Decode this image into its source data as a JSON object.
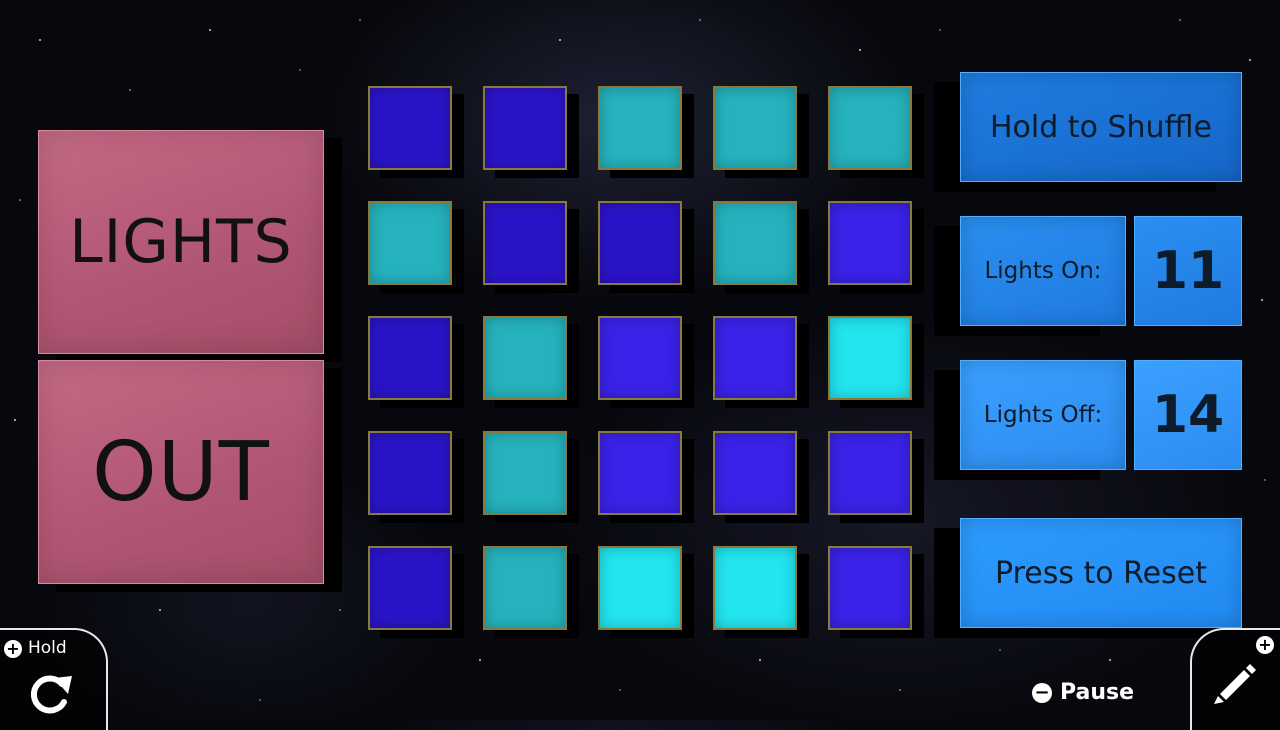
{
  "title": {
    "line1": "LIGHTS",
    "line2": "OUT"
  },
  "grid": {
    "colors": {
      "dark": "#2a14c8",
      "violet": "#3a22e8",
      "teal": "#25b2bd",
      "cyan": "#22e5ef"
    },
    "rows": [
      [
        "dark",
        "dark",
        "teal",
        "teal",
        "teal"
      ],
      [
        "teal",
        "dark",
        "dark",
        "teal",
        "violet"
      ],
      [
        "dark",
        "teal",
        "violet",
        "violet",
        "cyan"
      ],
      [
        "dark",
        "teal",
        "violet",
        "violet",
        "violet"
      ],
      [
        "dark",
        "teal",
        "cyan",
        "cyan",
        "violet"
      ]
    ]
  },
  "panel": {
    "shuffle_label": "Hold to Shuffle",
    "lights_on_label": "Lights On:",
    "lights_on_count": "11",
    "lights_off_label": "Lights Off:",
    "lights_off_count": "14",
    "reset_label": "Press to Reset"
  },
  "hud": {
    "hold_label": "Hold",
    "pause_label": "Pause",
    "icons": [
      "rotate-icon",
      "pencil-icon",
      "plus-icon",
      "minus-icon"
    ]
  }
}
